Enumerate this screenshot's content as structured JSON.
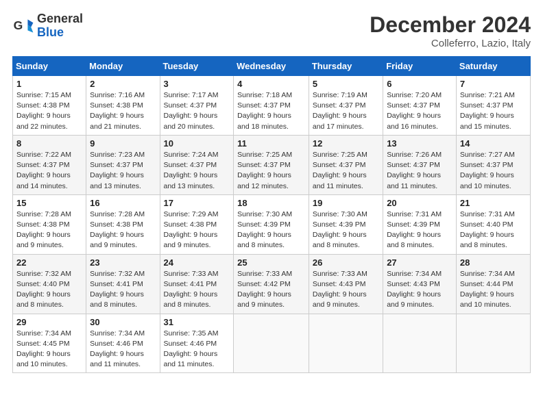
{
  "header": {
    "logo_general": "General",
    "logo_blue": "Blue",
    "month_title": "December 2024",
    "location": "Colleferro, Lazio, Italy"
  },
  "weekdays": [
    "Sunday",
    "Monday",
    "Tuesday",
    "Wednesday",
    "Thursday",
    "Friday",
    "Saturday"
  ],
  "weeks": [
    [
      {
        "day": "1",
        "sunrise": "7:15 AM",
        "sunset": "4:38 PM",
        "daylight": "9 hours and 22 minutes."
      },
      {
        "day": "2",
        "sunrise": "7:16 AM",
        "sunset": "4:38 PM",
        "daylight": "9 hours and 21 minutes."
      },
      {
        "day": "3",
        "sunrise": "7:17 AM",
        "sunset": "4:37 PM",
        "daylight": "9 hours and 20 minutes."
      },
      {
        "day": "4",
        "sunrise": "7:18 AM",
        "sunset": "4:37 PM",
        "daylight": "9 hours and 18 minutes."
      },
      {
        "day": "5",
        "sunrise": "7:19 AM",
        "sunset": "4:37 PM",
        "daylight": "9 hours and 17 minutes."
      },
      {
        "day": "6",
        "sunrise": "7:20 AM",
        "sunset": "4:37 PM",
        "daylight": "9 hours and 16 minutes."
      },
      {
        "day": "7",
        "sunrise": "7:21 AM",
        "sunset": "4:37 PM",
        "daylight": "9 hours and 15 minutes."
      }
    ],
    [
      {
        "day": "8",
        "sunrise": "7:22 AM",
        "sunset": "4:37 PM",
        "daylight": "9 hours and 14 minutes."
      },
      {
        "day": "9",
        "sunrise": "7:23 AM",
        "sunset": "4:37 PM",
        "daylight": "9 hours and 13 minutes."
      },
      {
        "day": "10",
        "sunrise": "7:24 AM",
        "sunset": "4:37 PM",
        "daylight": "9 hours and 13 minutes."
      },
      {
        "day": "11",
        "sunrise": "7:25 AM",
        "sunset": "4:37 PM",
        "daylight": "9 hours and 12 minutes."
      },
      {
        "day": "12",
        "sunrise": "7:25 AM",
        "sunset": "4:37 PM",
        "daylight": "9 hours and 11 minutes."
      },
      {
        "day": "13",
        "sunrise": "7:26 AM",
        "sunset": "4:37 PM",
        "daylight": "9 hours and 11 minutes."
      },
      {
        "day": "14",
        "sunrise": "7:27 AM",
        "sunset": "4:37 PM",
        "daylight": "9 hours and 10 minutes."
      }
    ],
    [
      {
        "day": "15",
        "sunrise": "7:28 AM",
        "sunset": "4:38 PM",
        "daylight": "9 hours and 9 minutes."
      },
      {
        "day": "16",
        "sunrise": "7:28 AM",
        "sunset": "4:38 PM",
        "daylight": "9 hours and 9 minutes."
      },
      {
        "day": "17",
        "sunrise": "7:29 AM",
        "sunset": "4:38 PM",
        "daylight": "9 hours and 9 minutes."
      },
      {
        "day": "18",
        "sunrise": "7:30 AM",
        "sunset": "4:39 PM",
        "daylight": "9 hours and 8 minutes."
      },
      {
        "day": "19",
        "sunrise": "7:30 AM",
        "sunset": "4:39 PM",
        "daylight": "9 hours and 8 minutes."
      },
      {
        "day": "20",
        "sunrise": "7:31 AM",
        "sunset": "4:39 PM",
        "daylight": "9 hours and 8 minutes."
      },
      {
        "day": "21",
        "sunrise": "7:31 AM",
        "sunset": "4:40 PM",
        "daylight": "9 hours and 8 minutes."
      }
    ],
    [
      {
        "day": "22",
        "sunrise": "7:32 AM",
        "sunset": "4:40 PM",
        "daylight": "9 hours and 8 minutes."
      },
      {
        "day": "23",
        "sunrise": "7:32 AM",
        "sunset": "4:41 PM",
        "daylight": "9 hours and 8 minutes."
      },
      {
        "day": "24",
        "sunrise": "7:33 AM",
        "sunset": "4:41 PM",
        "daylight": "9 hours and 8 minutes."
      },
      {
        "day": "25",
        "sunrise": "7:33 AM",
        "sunset": "4:42 PM",
        "daylight": "9 hours and 9 minutes."
      },
      {
        "day": "26",
        "sunrise": "7:33 AM",
        "sunset": "4:43 PM",
        "daylight": "9 hours and 9 minutes."
      },
      {
        "day": "27",
        "sunrise": "7:34 AM",
        "sunset": "4:43 PM",
        "daylight": "9 hours and 9 minutes."
      },
      {
        "day": "28",
        "sunrise": "7:34 AM",
        "sunset": "4:44 PM",
        "daylight": "9 hours and 10 minutes."
      }
    ],
    [
      {
        "day": "29",
        "sunrise": "7:34 AM",
        "sunset": "4:45 PM",
        "daylight": "9 hours and 10 minutes."
      },
      {
        "day": "30",
        "sunrise": "7:34 AM",
        "sunset": "4:46 PM",
        "daylight": "9 hours and 11 minutes."
      },
      {
        "day": "31",
        "sunrise": "7:35 AM",
        "sunset": "4:46 PM",
        "daylight": "9 hours and 11 minutes."
      },
      null,
      null,
      null,
      null
    ]
  ],
  "labels": {
    "sunrise": "Sunrise:",
    "sunset": "Sunset:",
    "daylight": "Daylight:"
  }
}
